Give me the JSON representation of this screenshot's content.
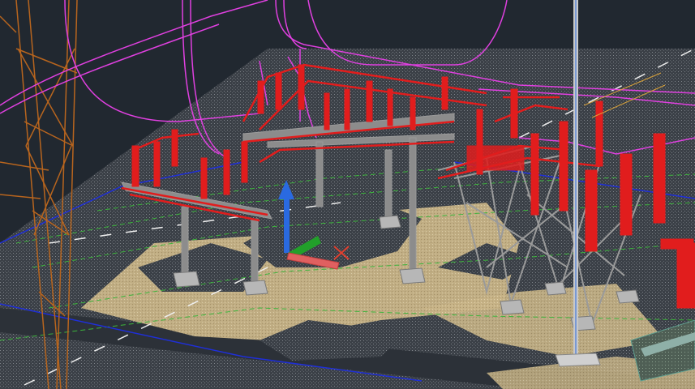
{
  "viewport": {
    "background": "#212830",
    "ground_color": "#3a4048",
    "pad_color": "#cbb68a",
    "colors": {
      "busbar": "#e11d1d",
      "bus_pipe": "#e03030",
      "steel": "#9a9a9a",
      "cable": "#e040e0",
      "tower": "#b8651e",
      "boundary": "#1f2fd8",
      "grid_dashed": "#3cb43c",
      "ucs_x": "#e06060",
      "ucs_y": "#22a02a",
      "ucs_z": "#2a6ae0",
      "mast": "#c8c8c8"
    },
    "ucs_icon": "ucs-axis-icon"
  }
}
